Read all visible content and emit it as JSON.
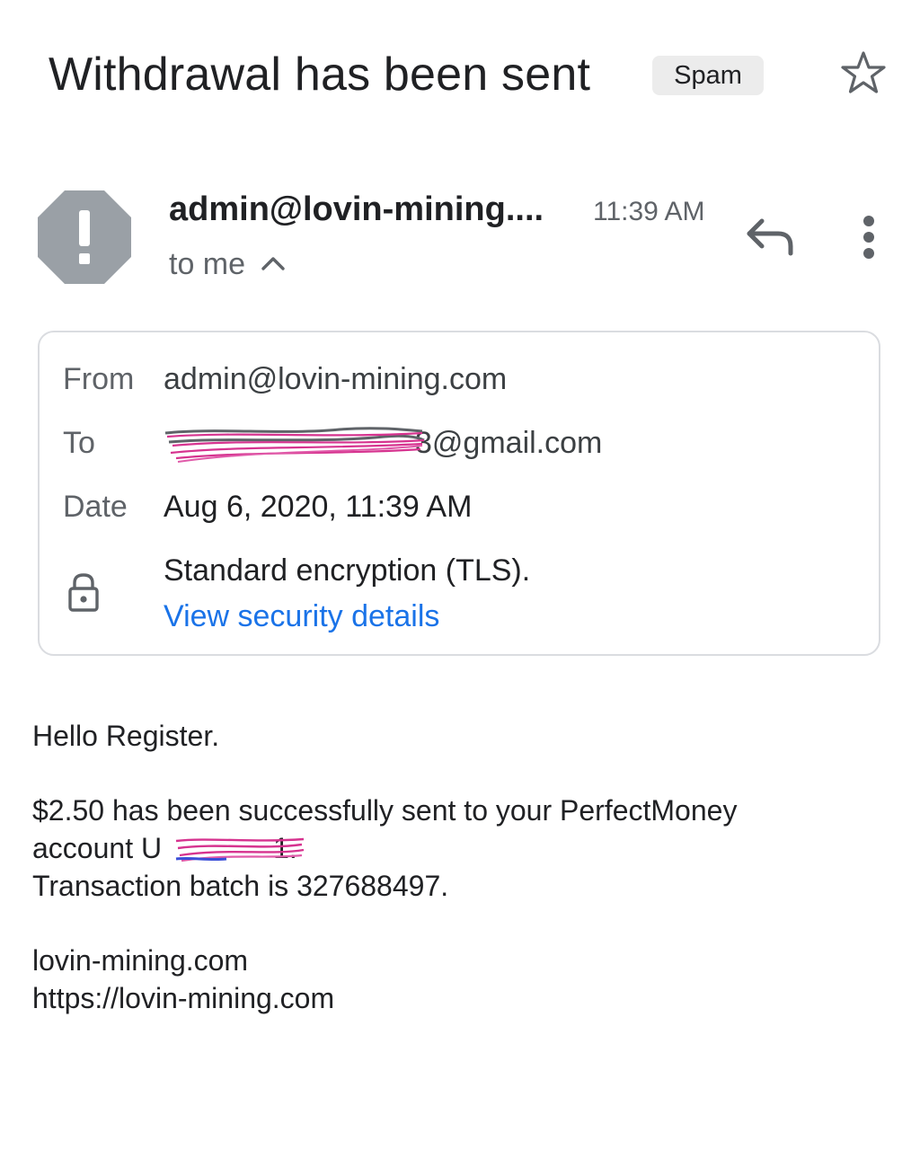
{
  "header": {
    "subject": "Withdrawal has been sent",
    "label": "Spam"
  },
  "message": {
    "sender": "admin@lovin-mining....",
    "time": "11:39 AM",
    "recipient_summary": "to me"
  },
  "details": {
    "from_label": "From",
    "from_value": "admin@lovin-mining.com",
    "to_label": "To",
    "to_value_visible": "3@gmail.com",
    "date_label": "Date",
    "date_value": "Aug 6, 2020, 11:39 AM",
    "encryption": "Standard encryption (TLS).",
    "security_link": "View security details"
  },
  "body": {
    "greeting": "Hello Register.",
    "line1": "$2.50 has been successfully sent to your PerfectMoney",
    "line2_prefix": "account U",
    "line2_suffix": "1.",
    "line3": "Transaction batch is 327688497.",
    "signature1": "lovin-mining.com",
    "signature2": "https://lovin-mining.com"
  },
  "colors": {
    "text": "#202124",
    "secondary": "#5f6368",
    "link": "#1a73e8",
    "badge_bg": "#ececec",
    "avatar": "#9aa0a6",
    "redaction": "#d6338f"
  },
  "icons": {
    "star": "star-outline-icon",
    "avatar": "spam-warning-octagon-icon",
    "chevron": "chevron-up-icon",
    "reply": "reply-arrow-icon",
    "more": "more-vertical-icon",
    "lock": "lock-icon"
  }
}
